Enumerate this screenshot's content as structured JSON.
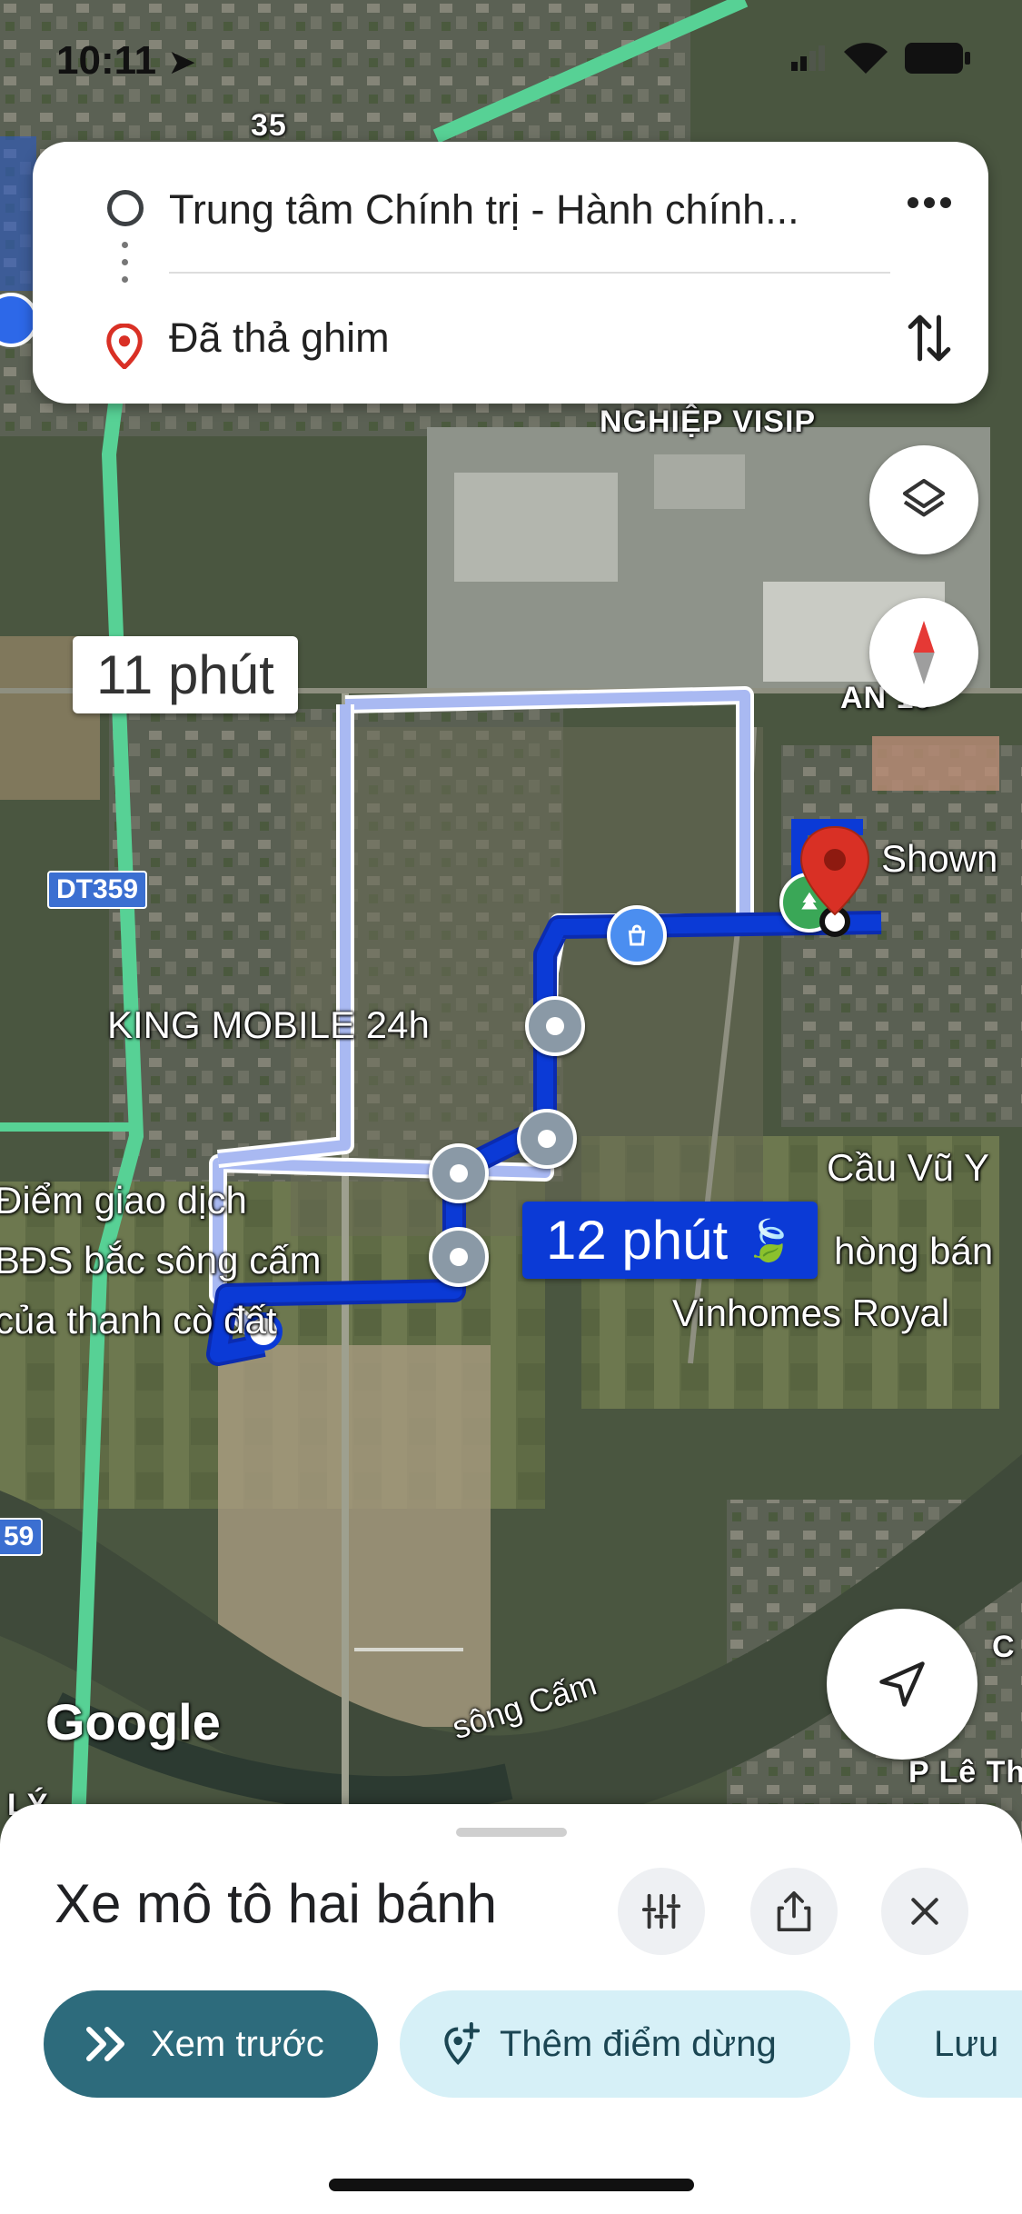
{
  "status_bar": {
    "time": "10:11"
  },
  "route_card": {
    "origin": "Trung tâm Chính trị - Hành chính...",
    "destination": "Đã thả ghim"
  },
  "map": {
    "labels": {
      "visip": "NGHIỆP VISIP",
      "an": "AN 19",
      "shown": "Shown",
      "king_mobile": "KING MOBILE 24h",
      "diem_giao_dich_1": "Điểm giao dịch",
      "diem_giao_dich_2": "BĐS bắc sông cấm",
      "diem_giao_dich_3": "của thanh cò đất",
      "cau_vu_yen": "Cầu Vũ Y",
      "phong_ban": "hòng bán",
      "vinhomes": "Vinhomes Royal",
      "song_cam": "sông Cấm",
      "p_le_th": "P Lê Th",
      "ly": "LÝ",
      "road_35": "35",
      "c": "C"
    },
    "road_shields": {
      "dt359": "DT359",
      "r59": "59"
    },
    "eta_alternate": "11 phút",
    "eta_selected": "12 phút",
    "google_logo": "Google"
  },
  "sheet": {
    "mode_title": "Xe mô tô hai bánh",
    "chips": {
      "preview": "Xem trước",
      "add_stop": "Thêm điểm dừng",
      "save": "Lưu"
    }
  },
  "colors": {
    "route_selected": "#0b3ad6",
    "route_alternate": "#a9b9f2",
    "destination_pin": "#d93025",
    "primary_chip": "#2d6b7c",
    "secondary_chip": "#d6f0f7"
  }
}
